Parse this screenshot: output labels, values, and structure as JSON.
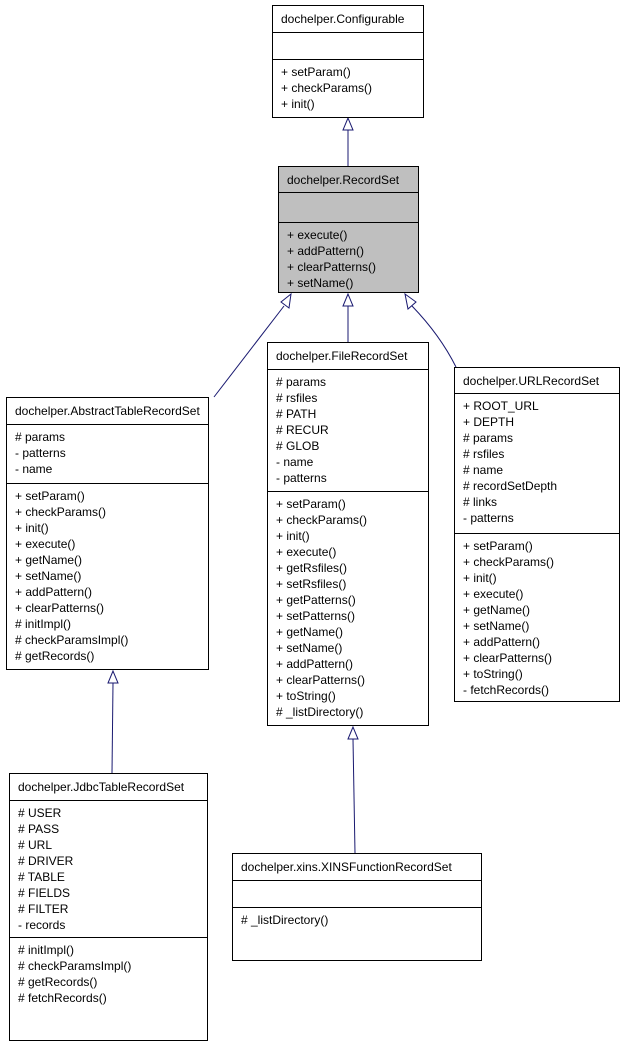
{
  "edge_color": "#191970",
  "highlight_color": "#bfbfbf",
  "classes": [
    {
      "id": "configurable",
      "name": "dochelper.Configurable",
      "attributes": [],
      "methods": [
        "+ setParam()",
        "+ checkParams()",
        "+ init()"
      ]
    },
    {
      "id": "recordset",
      "name": "dochelper.RecordSet",
      "current": true,
      "attributes": [],
      "methods": [
        "+ execute()",
        "+ addPattern()",
        "+ clearPatterns()",
        "+ setName()"
      ]
    },
    {
      "id": "abstracttablerecordset",
      "name": "dochelper.AbstractTableRecordSet",
      "attributes": [
        "# params",
        "- patterns",
        "- name"
      ],
      "methods": [
        "+ setParam()",
        "+ checkParams()",
        "+ init()",
        "+ execute()",
        "+ getName()",
        "+ setName()",
        "+ addPattern()",
        "+ clearPatterns()",
        "# initImpl()",
        "# checkParamsImpl()",
        "# getRecords()"
      ]
    },
    {
      "id": "filerecordset",
      "name": "dochelper.FileRecordSet",
      "attributes": [
        "# params",
        "# rsfiles",
        "# PATH",
        "# RECUR",
        "# GLOB",
        "- name",
        "- patterns"
      ],
      "methods": [
        "+ setParam()",
        "+ checkParams()",
        "+ init()",
        "+ execute()",
        "+ getRsfiles()",
        "+ setRsfiles()",
        "+ getPatterns()",
        "+ setPatterns()",
        "+ getName()",
        "+ setName()",
        "+ addPattern()",
        "+ clearPatterns()",
        "+ toString()",
        "# _listDirectory()"
      ]
    },
    {
      "id": "urlrecordset",
      "name": "dochelper.URLRecordSet",
      "attributes": [
        "+ ROOT_URL",
        "+ DEPTH",
        "# params",
        "# rsfiles",
        "# name",
        "# recordSetDepth",
        "# links",
        "- patterns"
      ],
      "methods": [
        "+ setParam()",
        "+ checkParams()",
        "+ init()",
        "+ execute()",
        "+ getName()",
        "+ setName()",
        "+ addPattern()",
        "+ clearPatterns()",
        "+ toString()",
        "- fetchRecords()"
      ]
    },
    {
      "id": "jdbctablerecordset",
      "name": "dochelper.JdbcTableRecordSet",
      "attributes": [
        "# USER",
        "# PASS",
        "# URL",
        "# DRIVER",
        "# TABLE",
        "# FIELDS",
        "# FILTER",
        "- records"
      ],
      "methods": [
        "# initImpl()",
        "# checkParamsImpl()",
        "# getRecords()",
        "# fetchRecords()"
      ]
    },
    {
      "id": "xinsfunctionrecordset",
      "name": "dochelper.xins.XINSFunctionRecordSet",
      "attributes": [],
      "methods": [
        "# _listDirectory()"
      ]
    }
  ],
  "inheritance": [
    {
      "child": "dochelper.RecordSet",
      "parent": "dochelper.Configurable"
    },
    {
      "child": "dochelper.AbstractTableRecordSet",
      "parent": "dochelper.RecordSet"
    },
    {
      "child": "dochelper.FileRecordSet",
      "parent": "dochelper.RecordSet"
    },
    {
      "child": "dochelper.URLRecordSet",
      "parent": "dochelper.RecordSet"
    },
    {
      "child": "dochelper.JdbcTableRecordSet",
      "parent": "dochelper.AbstractTableRecordSet"
    },
    {
      "child": "dochelper.xins.XINSFunctionRecordSet",
      "parent": "dochelper.FileRecordSet"
    }
  ]
}
